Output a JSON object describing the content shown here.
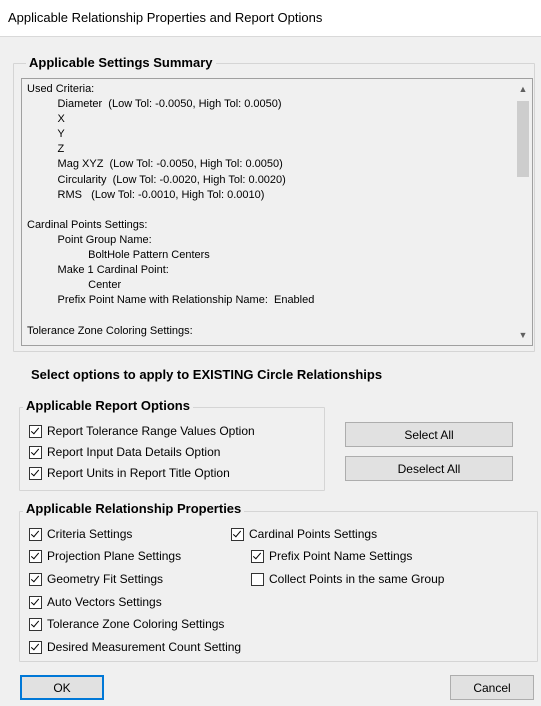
{
  "window": {
    "title": "Applicable Relationship Properties and Report Options"
  },
  "summary": {
    "legend": "Applicable Settings Summary",
    "text": "Used Criteria:\n          Diameter  (Low Tol: -0.0050, High Tol: 0.0050)\n          X\n          Y\n          Z\n          Mag XYZ  (Low Tol: -0.0050, High Tol: 0.0050)\n          Circularity  (Low Tol: -0.0020, High Tol: 0.0020)\n          RMS   (Low Tol: -0.0010, High Tol: 0.0010)\n\nCardinal Points Settings:\n          Point Group Name:\n                    BoltHole Pattern Centers\n          Make 1 Cardinal Point:\n                    Center\n          Prefix Point Name with Relationship Name:  Enabled\n\nTolerance Zone Coloring Settings:"
  },
  "main": {
    "heading": "Select options to apply to EXISTING Circle Relationships"
  },
  "report_options": {
    "legend": "Applicable Report Options",
    "items": [
      {
        "label": "Report Tolerance Range Values Option",
        "checked": true
      },
      {
        "label": "Report Input Data Details Option",
        "checked": true
      },
      {
        "label": "Report Units in Report Title Option",
        "checked": true
      }
    ],
    "select_all": "Select All",
    "deselect_all": "Deselect All"
  },
  "relationship_props": {
    "legend": "Applicable Relationship Properties",
    "items": [
      {
        "label": "Criteria Settings",
        "checked": true
      },
      {
        "label": "Projection Plane Settings",
        "checked": true
      },
      {
        "label": "Geometry Fit Settings",
        "checked": true
      },
      {
        "label": "Auto Vectors Settings",
        "checked": true
      },
      {
        "label": "Tolerance Zone Coloring Settings",
        "checked": true
      },
      {
        "label": "Desired Measurement Count Setting",
        "checked": true
      },
      {
        "label": "Cardinal Points Settings",
        "checked": true
      },
      {
        "label": "Prefix Point Name Settings",
        "checked": true
      },
      {
        "label": "Collect Points in the same Group",
        "checked": false
      }
    ]
  },
  "buttons": {
    "ok": "OK",
    "cancel": "Cancel"
  }
}
